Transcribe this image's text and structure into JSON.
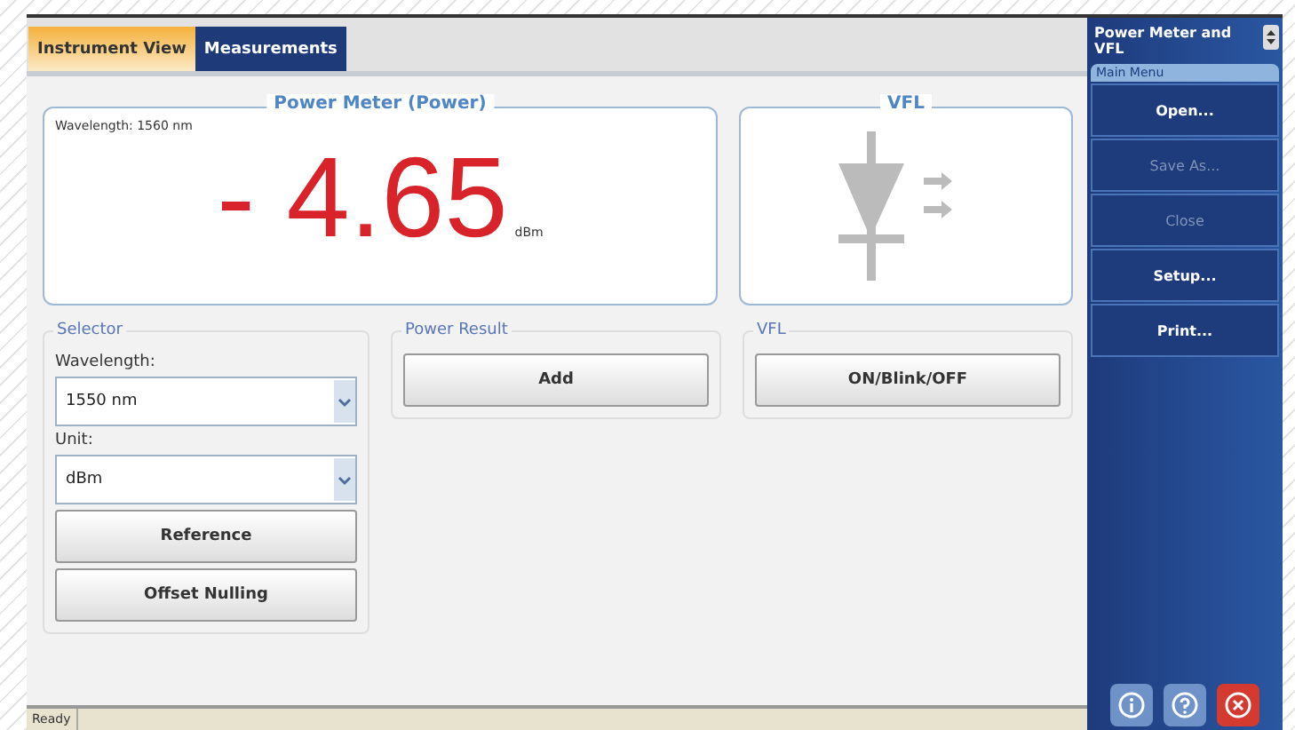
{
  "tabs": [
    {
      "label": "Instrument View",
      "selected": true
    },
    {
      "label": "Measurements",
      "selected": false
    }
  ],
  "power_meter": {
    "title": "Power Meter (Power)",
    "wavelength": "Wavelength: 1560 nm",
    "reading": "- 4.65",
    "unit": "dBm"
  },
  "vfl_panel": {
    "title": "VFL"
  },
  "selector": {
    "title": "Selector",
    "wavelength_label": "Wavelength:",
    "wavelength_value": "1550 nm",
    "unit_label": "Unit:",
    "unit_value": "dBm",
    "buttons": [
      "Reference",
      "Offset Nulling"
    ]
  },
  "power_result": {
    "title": "Power Result",
    "button": "Add"
  },
  "vfl_group": {
    "title": "VFL",
    "button": "ON/Blink/OFF"
  },
  "sidebar": {
    "title": "Power Meter and VFL",
    "menu_title": "Main Menu",
    "items": [
      {
        "label": "Open...",
        "disabled": false
      },
      {
        "label": "Save As...",
        "disabled": true
      },
      {
        "label": "Close",
        "disabled": true
      },
      {
        "label": "Setup...",
        "disabled": false
      },
      {
        "label": "Print...",
        "disabled": false
      }
    ]
  },
  "status_bar": {
    "text": "Ready"
  }
}
